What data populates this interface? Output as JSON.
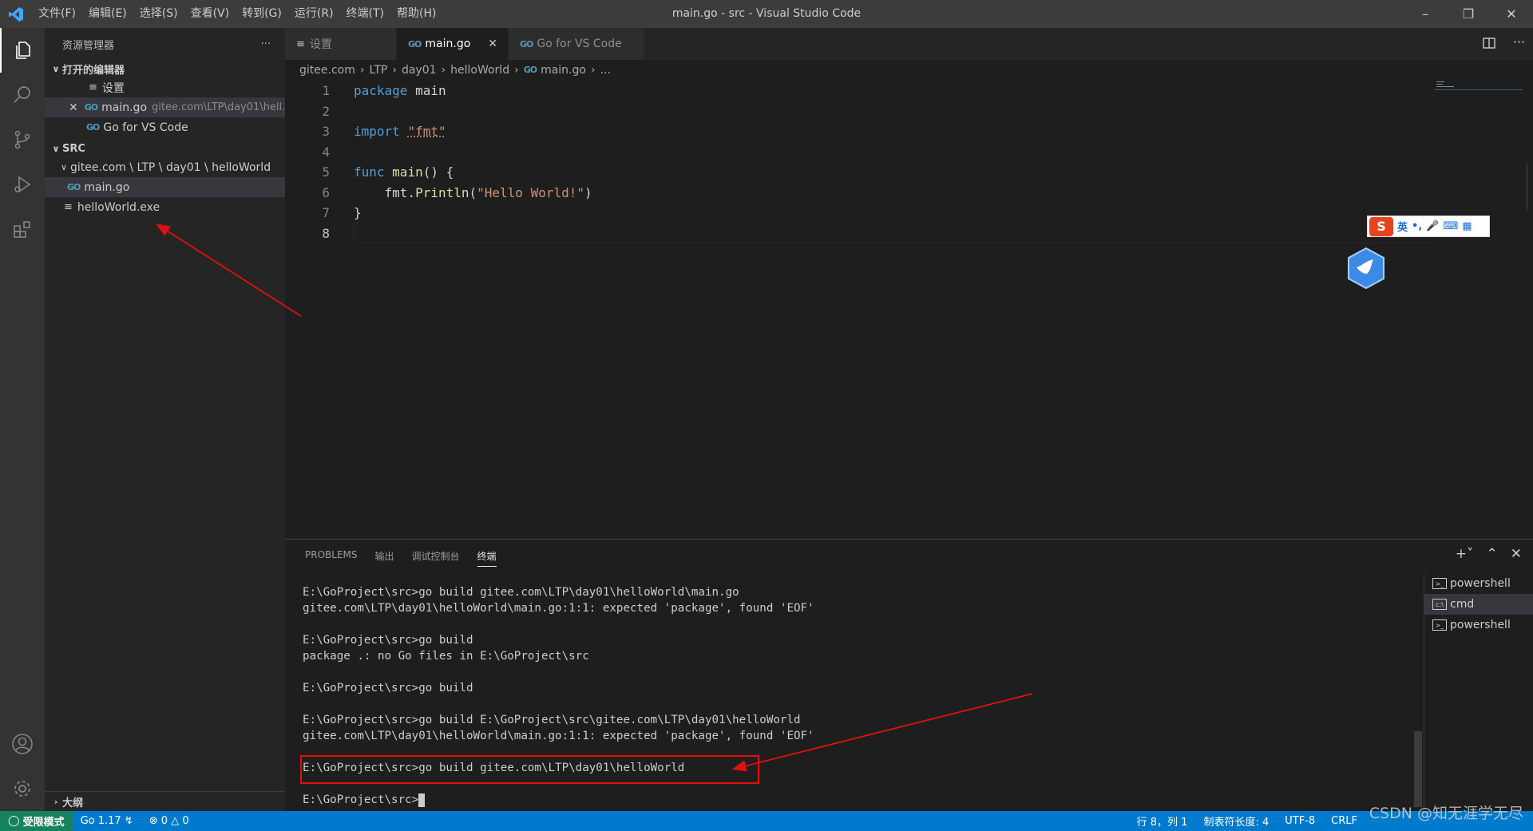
{
  "titlebar": {
    "menus": [
      "文件(F)",
      "编辑(E)",
      "选择(S)",
      "查看(V)",
      "转到(G)",
      "运行(R)",
      "终端(T)",
      "帮助(H)"
    ],
    "window_title": "main.go - src - Visual Studio Code"
  },
  "sidebar": {
    "title": "资源管理器",
    "more": "···",
    "open_editors_label": "打开的编辑器",
    "open_editors": [
      {
        "icon": "settings-file-icon",
        "name": "设置",
        "path": ""
      },
      {
        "icon": "go-file-icon",
        "name": "main.go",
        "path": "gitee.com\\LTP\\day01\\hell..."
      },
      {
        "icon": "go-file-icon",
        "name": "Go for VS Code",
        "path": ""
      }
    ],
    "src_label": "SRC",
    "folder": "gitee.com \\ LTP \\ day01 \\ helloWorld",
    "files": [
      "main.go",
      "helloWorld.exe"
    ],
    "outline_label": "大纲"
  },
  "tabs": [
    {
      "icon": "settings-file-icon",
      "label": "设置"
    },
    {
      "icon": "go-file-icon",
      "label": "main.go",
      "active": true
    },
    {
      "icon": "go-file-icon",
      "label": "Go for VS Code"
    }
  ],
  "breadcrumb": [
    "gitee.com",
    "LTP",
    "day01",
    "helloWorld",
    "main.go",
    "..."
  ],
  "editor": {
    "line_numbers": [
      "1",
      "2",
      "3",
      "4",
      "5",
      "6",
      "7",
      "8"
    ],
    "code": {
      "l1_kw": "package",
      "l1_rest": " main",
      "l3_kw": "import",
      "l3_str": "\"fmt\"",
      "l5_kw": "func",
      "l5_fn": "main",
      "l5_rest": "() {",
      "l6_pkg": "    fmt.",
      "l6_fn": "Println",
      "l6_open": "(",
      "l6_str": "\"Hello World!\"",
      "l6_close": ")",
      "l7": "}"
    },
    "current_line": 8
  },
  "ime": {
    "logo": "S",
    "lang": "英",
    "punct": "•,"
  },
  "panel": {
    "tabs": [
      "PROBLEMS",
      "输出",
      "调试控制台",
      "终端"
    ],
    "active_tab": "终端",
    "terminal_lines": [
      "E:\\GoProject\\src>go build gitee.com\\LTP\\day01\\helloWorld\\main.go",
      "gitee.com\\LTP\\day01\\helloWorld\\main.go:1:1: expected 'package', found 'EOF'",
      "",
      "E:\\GoProject\\src>go build",
      "package .: no Go files in E:\\GoProject\\src",
      "",
      "E:\\GoProject\\src>go build",
      "",
      "E:\\GoProject\\src>go build E:\\GoProject\\src\\gitee.com\\LTP\\day01\\helloWorld",
      "gitee.com\\LTP\\day01\\helloWorld\\main.go:1:1: expected 'package', found 'EOF'",
      "",
      "E:\\GoProject\\src>go build gitee.com\\LTP\\day01\\helloWorld",
      "",
      "E:\\GoProject\\src>"
    ],
    "terminals": [
      "powershell",
      "cmd",
      "powershell"
    ],
    "selected_terminal": 1
  },
  "statusbar": {
    "restricted": "受限模式",
    "go_version": "Go 1.17",
    "errors": "0",
    "warnings": "0",
    "position": "行 8，列 1",
    "tab_size": "制表符长度: 4",
    "encoding": "UTF-8",
    "eol": "CRLF"
  },
  "watermark": "CSDN @知无涯学无尽",
  "colors": {
    "accent": "#007acc",
    "restricted": "#16825d",
    "annotation": "#e01010",
    "keyword": "#569cd6",
    "string": "#ce9178",
    "function": "#dcdcaa"
  }
}
